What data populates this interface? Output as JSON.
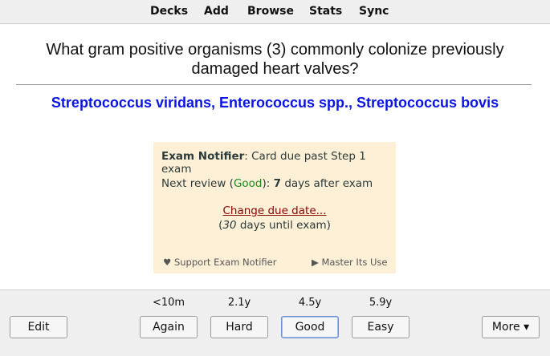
{
  "nav": {
    "decks": "Decks",
    "add": "Add",
    "browse": "Browse",
    "stats": "Stats",
    "sync": "Sync"
  },
  "card": {
    "question": "What gram positive organisms (3) commonly colonize previously damaged heart valves?",
    "answer": "Streptococcus viridans, Enterococcus spp., Streptococcus bovis"
  },
  "notifier": {
    "title": "Exam Notifier",
    "title_rest": ": Card due past Step 1 exam",
    "next_prefix": "Next review (",
    "next_ease": "Good",
    "next_mid": "): ",
    "next_days": "7",
    "next_suffix": " days after exam",
    "change_link": "Change due date...",
    "until_open": "(",
    "until_days": "30",
    "until_rest": " days until exam)",
    "support": "♥ Support Exam Notifier",
    "master": "▶ Master Its Use"
  },
  "reviewer": {
    "edit_label": "Edit",
    "more_label": "More ▾",
    "answers": [
      {
        "interval": "<10m",
        "label": "Again"
      },
      {
        "interval": "2.1y",
        "label": "Hard"
      },
      {
        "interval": "4.5y",
        "label": "Good",
        "focused": true
      },
      {
        "interval": "5.9y",
        "label": "Easy"
      }
    ]
  }
}
